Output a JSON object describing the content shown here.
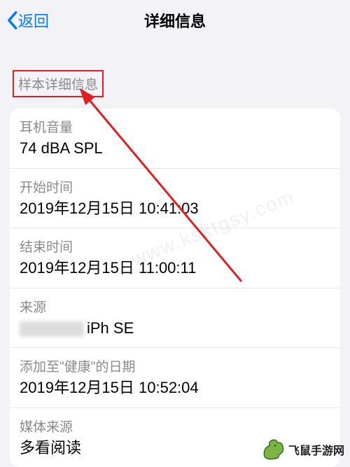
{
  "nav": {
    "back": "返回",
    "title": "详细信息"
  },
  "section": {
    "header": "样本详细信息"
  },
  "rows": {
    "volume": {
      "label": "耳机音量",
      "value": "74 dBA SPL"
    },
    "start": {
      "label": "开始时间",
      "value": "2019年12月15日 10:41:03"
    },
    "end": {
      "label": "结束时间",
      "value": "2019年12月15日 11:00:11"
    },
    "source": {
      "label": "来源",
      "device": "iPh SE"
    },
    "addedDate": {
      "label": "添加至\"健康\"的日期",
      "value": "2019年12月15日 10:52:04"
    },
    "mediaSource": {
      "label": "媒体来源",
      "value": "多看阅读"
    }
  },
  "watermark": "www.ksktgsy.com",
  "footer": {
    "text": "飞鼠手游网"
  },
  "colors": {
    "accent": "#007aff",
    "annotation": "#e02020"
  }
}
